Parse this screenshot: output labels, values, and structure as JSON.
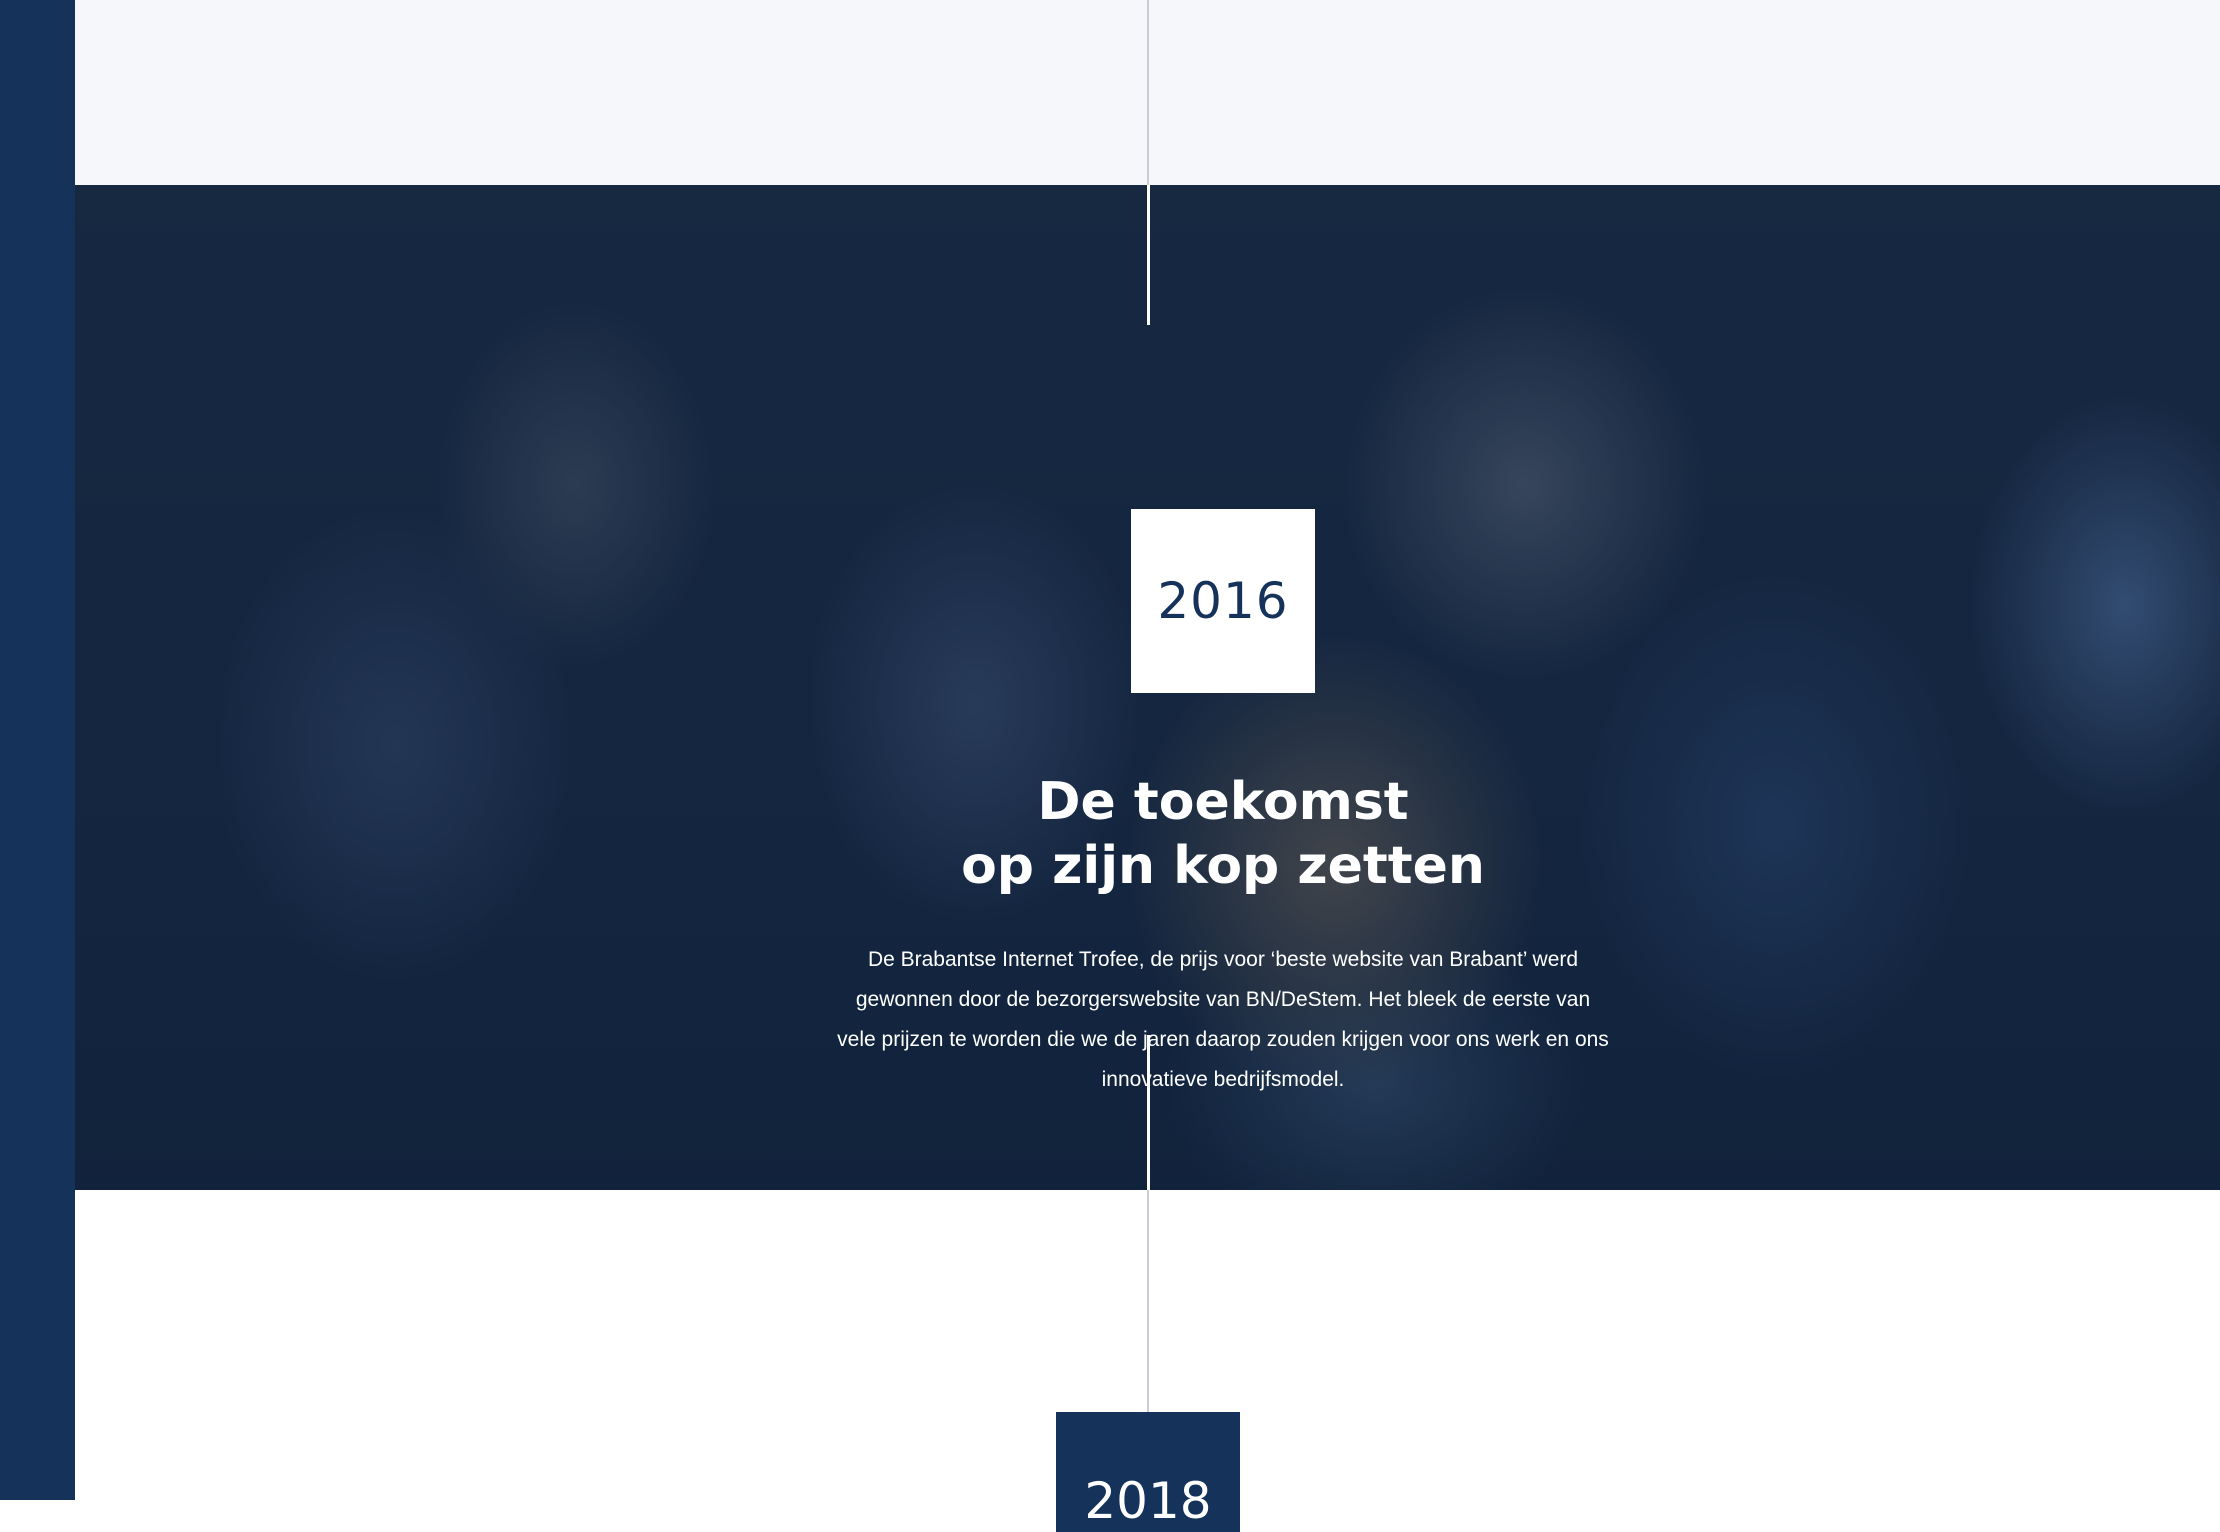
{
  "timeline": {
    "current": {
      "year": "2016",
      "title_line1": "De toekomst",
      "title_line2": "op zijn kop zetten",
      "text": "De Brabantse Internet Trofee, de prijs voor ‘beste website van Brabant’ werd gewonnen door de bezorgerswebsite van BN/DeStem. Het bleek de eerste van vele prijzen te worden die we de jaren daarop zouden krijgen voor ons werk en ons innovatieve bedrijfsmodel."
    },
    "next": {
      "year": "2018"
    }
  },
  "colors": {
    "brand_navy": "#15325a",
    "light_band": "#f6f7fa",
    "timeline_line": "#c9cdd3"
  }
}
